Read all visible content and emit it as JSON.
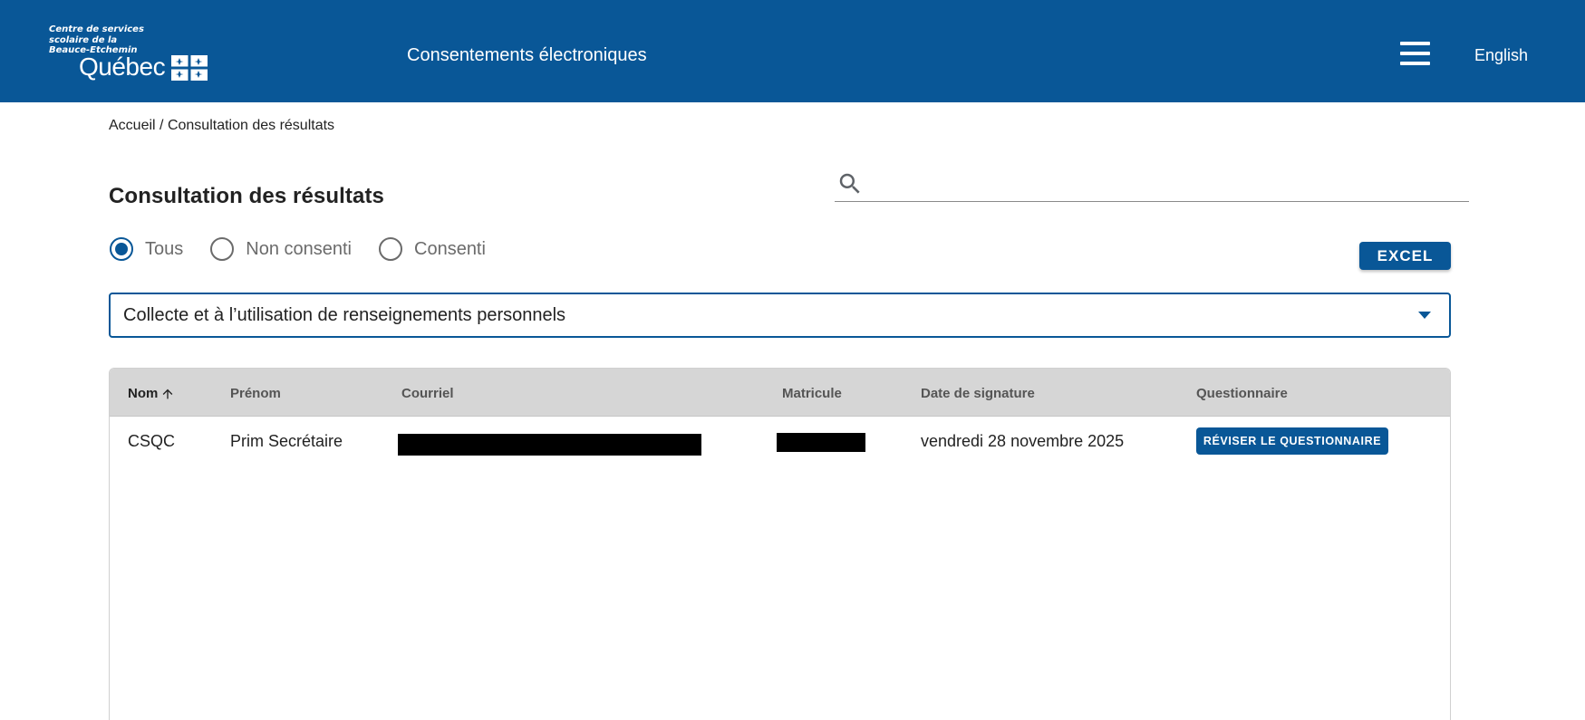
{
  "header": {
    "logo": {
      "org_line1": "Centre de services",
      "org_line2": "scolaire de la",
      "org_line3": "Beauce-Etchemin",
      "wordmark": "Québec",
      "flag_icon": "quebec-fleurdelise-icon"
    },
    "app_title": "Consentements électroniques",
    "menu_icon": "hamburger-menu-icon",
    "language_link": "English"
  },
  "breadcrumb": {
    "items": [
      "Accueil",
      "Consultation des résultats"
    ],
    "separator": "/"
  },
  "page": {
    "title": "Consultation des résultats"
  },
  "search": {
    "icon": "search-icon",
    "value": "",
    "placeholder": ""
  },
  "filters": {
    "options": [
      {
        "label": "Tous",
        "checked": true
      },
      {
        "label": "Non consenti",
        "checked": false
      },
      {
        "label": "Consenti",
        "checked": false
      }
    ]
  },
  "toolbar": {
    "excel_label": "EXCEL"
  },
  "form_select": {
    "value": "Collecte et à l’utilisation de renseignements personnels",
    "caret_icon": "caret-down-icon"
  },
  "table": {
    "columns": [
      {
        "key": "nom",
        "label": "Nom",
        "sorted": "asc"
      },
      {
        "key": "prenom",
        "label": "Prénom"
      },
      {
        "key": "courriel",
        "label": "Courriel"
      },
      {
        "key": "matricule",
        "label": "Matricule"
      },
      {
        "key": "date_signature",
        "label": "Date de signature"
      },
      {
        "key": "questionnaire",
        "label": "Questionnaire"
      }
    ],
    "sort_icon": "arrow-up-icon",
    "rows": [
      {
        "nom": "CSQC",
        "prenom": "Prim Secrétaire",
        "courriel": "",
        "matricule": "",
        "date_signature": "vendredi 28 novembre 2025",
        "questionnaire_button": "RÉVISER LE QUESTIONNAIRE"
      }
    ]
  },
  "colors": {
    "brand_blue": "#095797",
    "header_text": "#ffffff",
    "table_header_bg": "#d6d6d6",
    "radio_unchecked": "#6b6b6b"
  }
}
